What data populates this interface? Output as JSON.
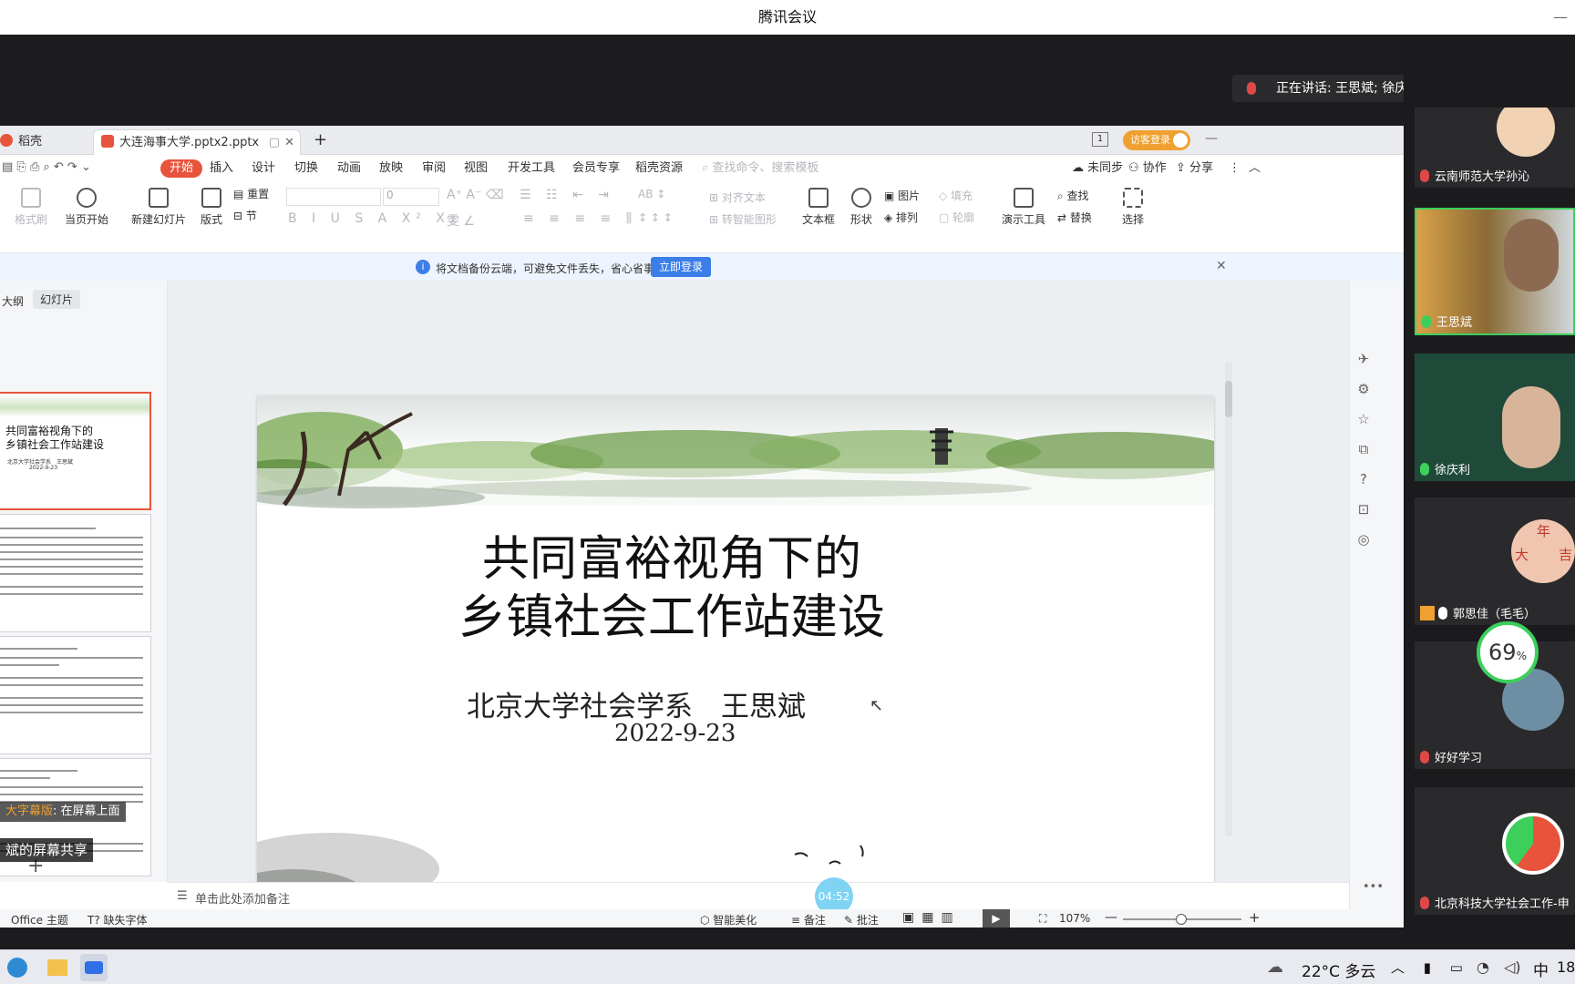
{
  "window": {
    "title": "腾讯会议"
  },
  "wps": {
    "tabs": [
      {
        "label": "稻壳"
      },
      {
        "label": "大连海事大学.pptx2.pptx"
      }
    ],
    "login_button": "访客登录",
    "menus": [
      "开始",
      "插入",
      "设计",
      "切换",
      "动画",
      "放映",
      "审阅",
      "视图",
      "开发工具",
      "会员专享",
      "稻壳资源"
    ],
    "search_placeholder": "查找命令、搜索模板",
    "menu_right": [
      "未同步",
      "协作",
      "分享"
    ],
    "ribbon": {
      "format_brush": "格式刷",
      "play_current": "当页开始",
      "new_slide": "新建幻灯片",
      "layout": "版式",
      "reset": "重置",
      "section": "节",
      "font_size": "0",
      "align_text": "对齐文本",
      "smart_shape": "转智能图形",
      "textbox": "文本框",
      "shape": "形状",
      "picture": "图片",
      "arrange": "排列",
      "fill": "填充",
      "outline": "轮廓",
      "present_tools": "演示工具",
      "find": "查找",
      "replace": "替换",
      "select": "选择"
    },
    "notice": {
      "text": "将文档备份云端，可避免文件丢失，省心省事",
      "button": "立即登录"
    },
    "left_tabs": [
      "大纲",
      "幻灯片"
    ],
    "thumb1": {
      "title_line1": "共同富裕视角下的",
      "title_line2": "乡镇社会工作站建设",
      "author": "北京大学社会学系　王思斌",
      "date": "2022-9-23"
    },
    "subtitle_overlay": {
      "highlight": "大字幕版",
      "rest": ": 在屏幕上面"
    },
    "slide": {
      "title_line1": "共同富裕视角下的",
      "title_line2": "乡镇社会工作站建设",
      "author": "北京大学社会学系　王思斌",
      "date": "2022-9-23"
    },
    "notes_placeholder": "单击此处添加备注",
    "timer": "04:52",
    "status": {
      "theme": "Office 主题",
      "missing_font": "缺失字体",
      "beautify": "智能美化",
      "notes": "备注",
      "comments": "批注",
      "zoom": "107%"
    }
  },
  "meeting": {
    "speaking": "正在讲话: 王思斌; 徐庆利;",
    "participants": [
      {
        "name": "云南师范大学孙沁",
        "mic": "off"
      },
      {
        "name": "王思斌",
        "mic": "on"
      },
      {
        "name": "徐庆利",
        "mic": "on"
      },
      {
        "name": "郭思佳（毛毛）",
        "mic": "on"
      },
      {
        "name": "好好学习",
        "mic": "off"
      },
      {
        "name": "北京科技大学社会工作-申",
        "mic": "off"
      }
    ],
    "net_percent": "69",
    "net_unit": "%",
    "share_label": "斌的屏幕共享",
    "avatar_chars": [
      "年",
      "大",
      "吉"
    ]
  },
  "taskbar": {
    "weather": "22°C 多云",
    "ime": "中",
    "clock": "18"
  }
}
